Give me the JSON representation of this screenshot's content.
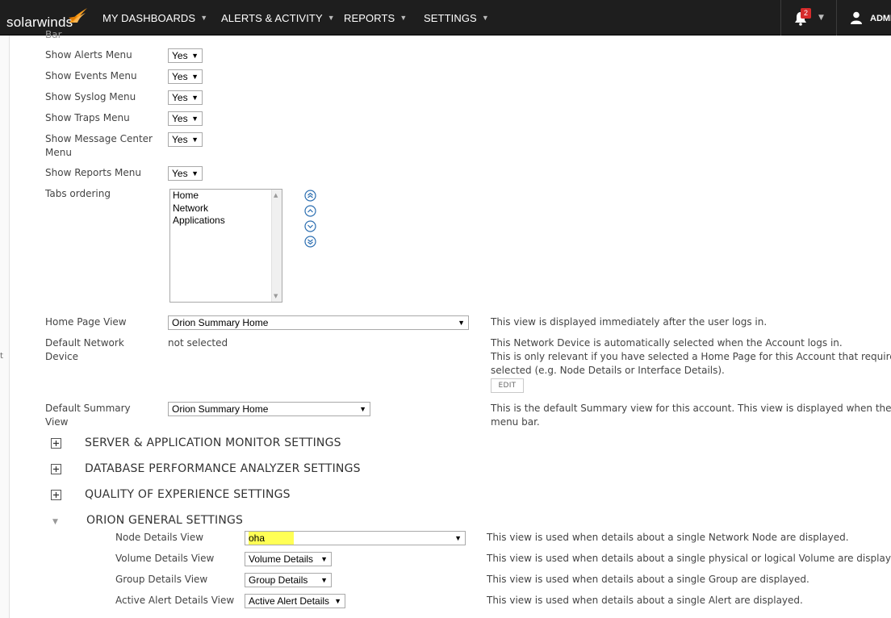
{
  "brand": {
    "name": "solarwinds",
    "color": "#f99d1c"
  },
  "nav": {
    "items": [
      {
        "label": "MY DASHBOARDS"
      },
      {
        "label": "ALERTS & ACTIVITY"
      },
      {
        "label": "REPORTS"
      },
      {
        "label": "SETTINGS"
      }
    ],
    "notifications_count": "2",
    "user_label": "ADMI"
  },
  "gutter": {
    "frag1": "t",
    "frag2": "Bar"
  },
  "menu_settings": {
    "truncated_label": "Bar",
    "rows": [
      {
        "label": "Show Alerts Menu",
        "value": "Yes"
      },
      {
        "label": "Show Events Menu",
        "value": "Yes"
      },
      {
        "label": "Show Syslog Menu",
        "value": "Yes"
      },
      {
        "label": "Show Traps Menu",
        "value": "Yes"
      },
      {
        "label": "Show Message Center Menu",
        "value": "Yes"
      },
      {
        "label": "Show Reports Menu",
        "value": "Yes"
      }
    ]
  },
  "tabs_ordering": {
    "label": "Tabs ordering",
    "options": [
      "Home",
      "Network",
      "Applications"
    ]
  },
  "home_page_view": {
    "label": "Home Page View",
    "value": "Orion Summary Home",
    "description": "This view is displayed immediately after the user logs in."
  },
  "default_network_device": {
    "label": "Default Network Device",
    "value": "not selected",
    "desc_line1": "This Network Device is automatically selected when the Account logs in.",
    "desc_line2": "This is only relevant if you have selected a Home Page for this Account that requires a Ne",
    "desc_line3": "selected (e.g. Node Details or Interface Details).",
    "edit_label": "EDIT"
  },
  "default_summary_view": {
    "label": "Default Summary View",
    "value": "Orion Summary Home",
    "desc_line1": "This is the default Summary view for this account. This view is displayed when the user cl",
    "desc_line2": "menu bar."
  },
  "sections": [
    {
      "title": "SERVER & APPLICATION MONITOR SETTINGS"
    },
    {
      "title": "DATABASE PERFORMANCE ANALYZER SETTINGS"
    },
    {
      "title": "QUALITY OF EXPERIENCE SETTINGS"
    },
    {
      "title": "ORION GENERAL SETTINGS"
    }
  ],
  "orion_general": {
    "rows": [
      {
        "label": "Node Details View",
        "value": "oha",
        "description": "This view is used when details about a single Network Node are displayed."
      },
      {
        "label": "Volume Details View",
        "value": "Volume Details",
        "description": "This view is used when details about a single physical or logical Volume are displayed."
      },
      {
        "label": "Group Details View",
        "value": "Group Details",
        "description": "This view is used when details about a single Group are displayed."
      },
      {
        "label": "Active Alert Details View",
        "value": "Active Alert Details",
        "description": "This view is used when details about a single Alert are displayed."
      }
    ]
  },
  "colors": {
    "topbar": "#1e1e1e",
    "highlight": "#ffff55",
    "badge": "#d62b2b"
  }
}
